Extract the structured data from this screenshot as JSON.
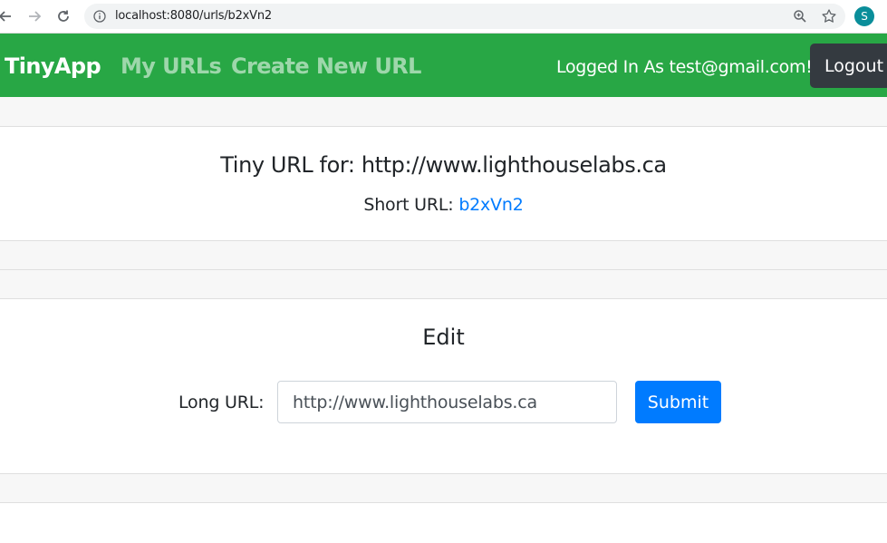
{
  "browser": {
    "url": "localhost:8080/urls/b2xVn2",
    "profile_initial": "S"
  },
  "navbar": {
    "brand": "TinyApp",
    "links": [
      "My URLs",
      "Create New URL"
    ],
    "logged_in_text": "Logged In As test@gmail.com!",
    "logout_label": "Logout"
  },
  "url_card": {
    "title": "Tiny URL for: http://www.lighthouselabs.ca",
    "short_url_label": "Short URL: ",
    "short_url_value": "b2xVn2"
  },
  "edit_card": {
    "title": "Edit",
    "long_url_label": "Long URL:",
    "long_url_value": "http://www.lighthouselabs.ca",
    "submit_label": "Submit"
  },
  "colors": {
    "navbar": "#28a745",
    "primary": "#007bff",
    "dark": "#343a40"
  }
}
